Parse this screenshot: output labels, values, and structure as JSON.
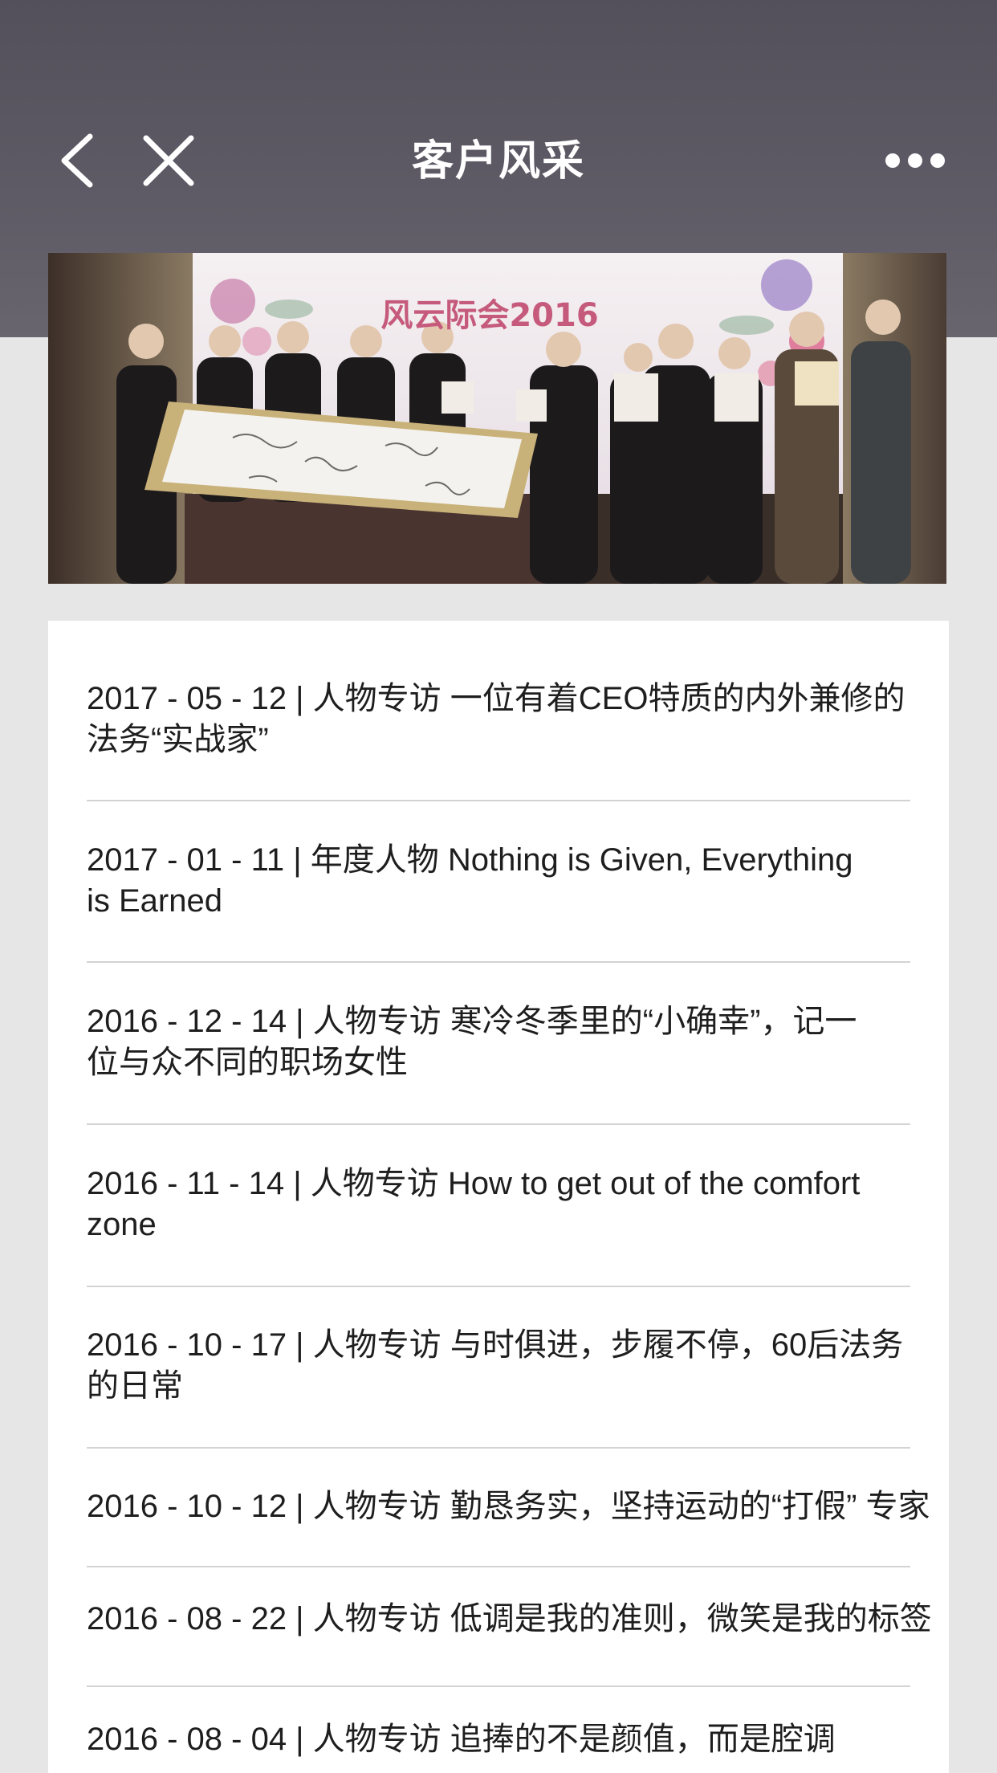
{
  "header": {
    "title": "客户风采",
    "back_icon": "chevron-left-icon",
    "close_icon": "close-icon",
    "more_icon": "more-horizontal-icon"
  },
  "banner": {
    "backdrop_text": "风云际会2016"
  },
  "articles": [
    {
      "date": "2017 - 05 - 12",
      "title": "人物专访 一位有着CEO特质的内外兼修的法务“实战家”",
      "line1": "2017 - 05 - 12 | 人物专访 一位有着CEO特质的内外兼修的",
      "line2": "法务“实战家”"
    },
    {
      "date": "2017 - 01 - 11",
      "title": "年度人物 Nothing is Given, Everything is Earned",
      "line1": "2017 - 01 - 11 | 年度人物 Nothing is Given, Everything",
      "line2": "is Earned"
    },
    {
      "date": "2016 - 12 - 14",
      "title": "人物专访 寒冷冬季里的“小确幸”，记一位与众不同的职场女性",
      "line1": "2016 - 12 - 14 | 人物专访 寒冷冬季里的“小确幸”，记一",
      "line2": "位与众不同的职场女性"
    },
    {
      "date": "2016 - 11 - 14",
      "title": "人物专访 How to get out of the comfort zone",
      "line1": "2016 - 11 - 14 | 人物专访 How to get out of the comfort",
      "line2": "zone"
    },
    {
      "date": "2016 - 10 - 17",
      "title": "人物专访 与时俱进，步履不停，60后法务的日常",
      "line1": "2016 - 10 - 17 | 人物专访 与时俱进，步履不停，60后法务",
      "line2": "的日常"
    },
    {
      "date": "2016 - 10 - 12",
      "title": "人物专访 勤恳务实，坚持运动的“打假” 专家",
      "line1": "2016 - 10 - 12 | 人物专访 勤恳务实，坚持运动的“打假” 专家",
      "line2": ""
    },
    {
      "date": "2016 - 08 - 22",
      "title": "人物专访 低调是我的准则，微笑是我的标签",
      "line1": "2016 - 08 - 22 | 人物专访 低调是我的准则，微笑是我的标签",
      "line2": ""
    },
    {
      "date": "2016 - 08 - 04",
      "title": "人物专访 追捧的不是颜值，而是腔调",
      "line1": "2016 - 08 - 04 | 人物专访 追捧的不是颜值，而是腔调",
      "line2": ""
    }
  ],
  "colors": {
    "header_bg": "#5a5660",
    "page_bg": "#e6e6e6",
    "list_bg": "#ffffff",
    "text": "#1e1e1e",
    "divider": "#d3d3d3"
  }
}
